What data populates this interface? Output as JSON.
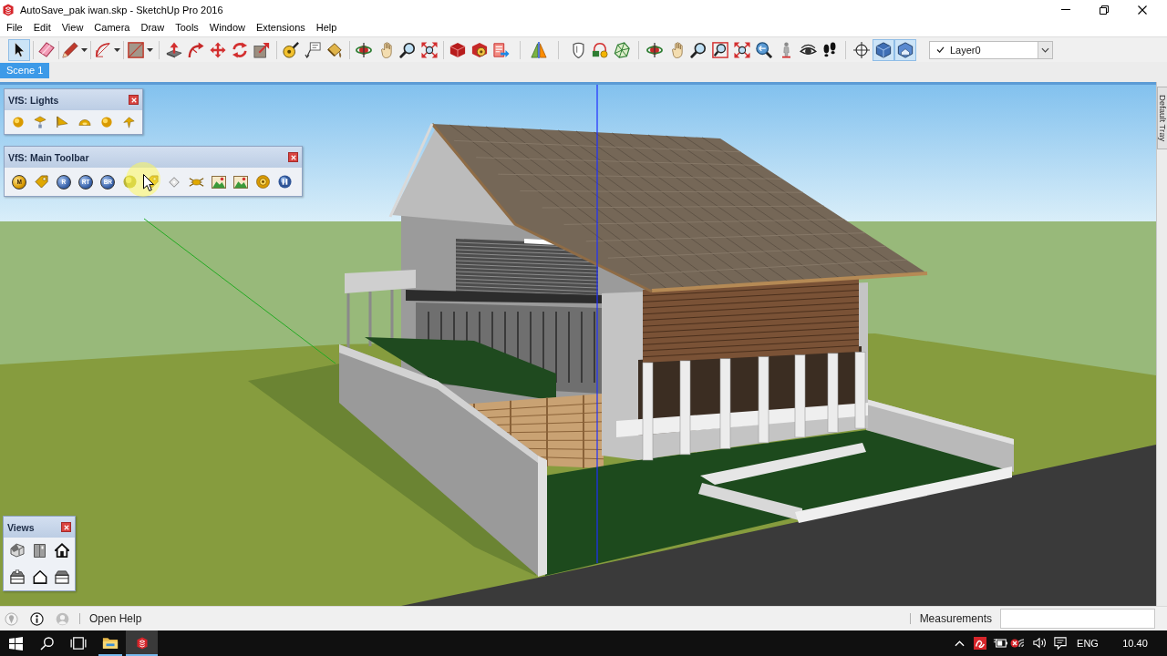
{
  "window": {
    "title": "AutoSave_pak iwan.skp - SketchUp Pro 2016"
  },
  "menu": [
    "File",
    "Edit",
    "View",
    "Camera",
    "Draw",
    "Tools",
    "Window",
    "Extensions",
    "Help"
  ],
  "toolbar": {
    "buttons": [
      {
        "selected": true
      },
      {
        "selected": false
      },
      {
        "selected": false
      },
      {
        "selected": false
      },
      {
        "selected": false
      },
      {
        "selected": false
      },
      {
        "selected": false
      },
      {
        "selected": false
      },
      {
        "selected": false
      },
      {
        "selected": false
      },
      {
        "selected": false
      },
      {
        "selected": false
      },
      {
        "selected": false
      },
      {
        "selected": false
      },
      {
        "selected": false
      },
      {
        "selected": false
      },
      {
        "selected": false
      },
      {
        "selected": false
      },
      {
        "selected": false
      },
      {
        "selected": false
      },
      {
        "selected": false
      },
      {
        "selected": false
      },
      {
        "selected": false
      },
      {
        "selected": false
      },
      {
        "selected": false
      },
      {
        "selected": false
      },
      {
        "selected": false
      },
      {
        "selected": false
      },
      {
        "selected": false
      },
      {
        "selected": false
      },
      {
        "selected": false
      },
      {
        "selected": false
      },
      {
        "selected": false
      },
      {
        "selected": false
      },
      {
        "selected": true
      },
      {
        "selected": true
      }
    ],
    "layer": {
      "value": "Layer0"
    }
  },
  "scene_tabs": [
    {
      "label": "Scene 1",
      "selected": true
    }
  ],
  "panels": [
    {
      "title": "VfS: Lights",
      "kind": "lights"
    },
    {
      "title": "VfS: Main Toolbar",
      "kind": "render",
      "buttons": [
        {
          "kind": "letter",
          "label": "M"
        },
        {
          "kind": "icon"
        },
        {
          "kind": "letter",
          "label": "R"
        },
        {
          "kind": "letter",
          "label": "RT"
        },
        {
          "kind": "letter",
          "label": "BR"
        },
        {
          "kind": "icon"
        },
        {
          "kind": "icon"
        },
        {
          "kind": "icon"
        },
        {
          "kind": "icon"
        },
        {
          "kind": "icon"
        },
        {
          "kind": "icon"
        },
        {
          "kind": "icon"
        },
        {
          "kind": "icon"
        }
      ]
    },
    {
      "title": "Views",
      "kind": "views"
    }
  ],
  "side_tray": {
    "tab": "Default Tray"
  },
  "status_bar": {
    "hint": "Open Help",
    "measurements_label": "Measurements"
  },
  "taskbar": {
    "apps": [
      {
        "selected": false
      },
      {
        "selected": true
      }
    ],
    "language": "ENG",
    "time": "10.40"
  }
}
